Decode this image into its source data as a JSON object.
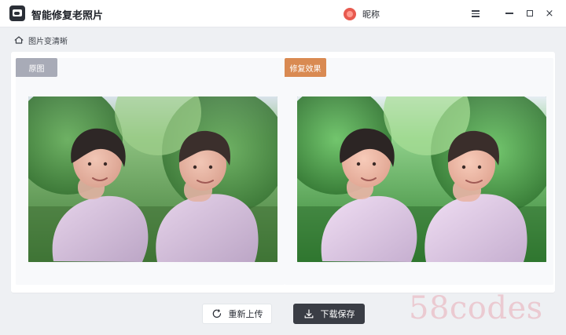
{
  "app": {
    "title": "智能修复老照片",
    "user_nickname": "昵称"
  },
  "breadcrumb": {
    "label": "图片变清晰"
  },
  "panes": {
    "left_tag": "原图",
    "right_tag": "修复效果"
  },
  "buttons": {
    "reupload": "重新上传",
    "download": "下载保存"
  },
  "watermark": {
    "text": "58codes"
  },
  "colors": {
    "accent_orange": "#d98a52",
    "tag_gray": "#a8abb7",
    "download_bg": "#3a3d45",
    "avatar_red": "#e85a4f",
    "watermark": "#e2566c"
  },
  "icons": {
    "app": "app-logo-icon",
    "avatar": "avatar-icon",
    "menu": "hamburger-menu-icon",
    "minimize": "minimize-icon",
    "maximize": "maximize-icon",
    "close": "close-icon",
    "home": "home-icon",
    "reupload": "refresh-icon",
    "download": "download-icon"
  }
}
